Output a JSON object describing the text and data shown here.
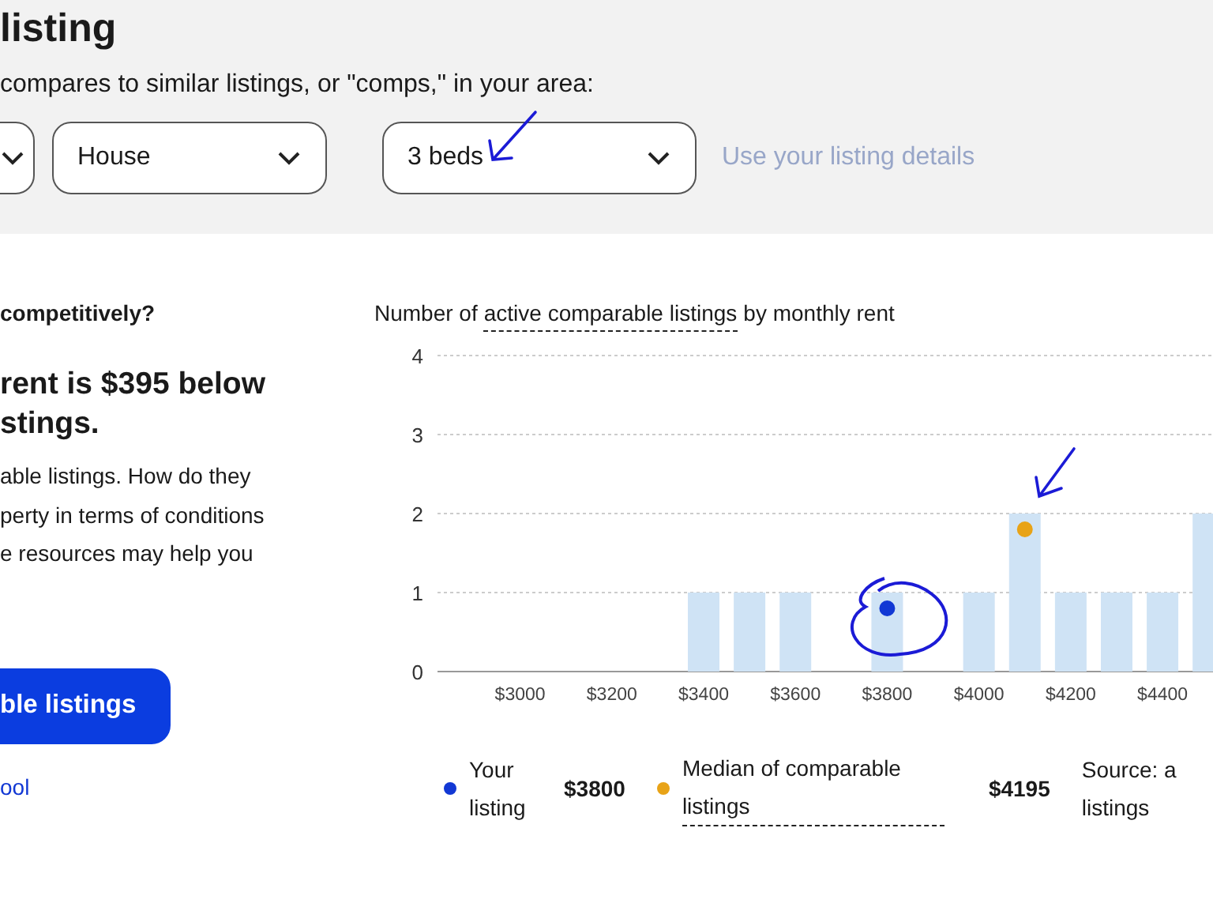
{
  "header": {
    "title": "listing",
    "subtitle": "compares to similar listings, or \"comps,\" in your area:"
  },
  "filters": [
    {
      "kind": "cut"
    },
    {
      "kind": "select",
      "value": "House"
    },
    {
      "kind": "select",
      "value": "3 beds"
    }
  ],
  "filters_link": "Use your listing details",
  "summary": {
    "question": "competitively?",
    "headline": [
      "rent is $395 below",
      "stings."
    ],
    "body": [
      "able listings. How do they",
      "perty in terms of conditions",
      "e resources may help you"
    ],
    "button": "ble listings",
    "link": "ool"
  },
  "chart": {
    "title_before": "Number of",
    "title_term": "active comparable listings",
    "title_after": "by monthly rent",
    "chart_data": {
      "type": "bar",
      "x": [
        3400,
        3500,
        3600,
        3800,
        4000,
        4100,
        4200,
        4300,
        4400,
        4500
      ],
      "values": [
        1,
        1,
        1,
        1,
        1,
        2,
        1,
        1,
        1,
        2
      ],
      "ylim": [
        0,
        4
      ],
      "yticks": [
        0,
        1,
        2,
        3,
        4
      ],
      "xticks": [
        {
          "value": 3000,
          "label": "$3000"
        },
        {
          "value": 3200,
          "label": "$3200"
        },
        {
          "value": 3400,
          "label": "$3400"
        },
        {
          "value": 3600,
          "label": "$3600"
        },
        {
          "value": 3800,
          "label": "$3800"
        },
        {
          "value": 4000,
          "label": "$4000"
        },
        {
          "value": 4200,
          "label": "$4200"
        },
        {
          "value": 4400,
          "label": "$4400"
        }
      ],
      "xlim": [
        2820,
        4510
      ],
      "grid": true
    },
    "legend": [
      {
        "label": "Your listing",
        "value": "$3800",
        "color": "#1238d4",
        "dotted": false
      },
      {
        "label": "Median of comparable listings",
        "value": "$4195",
        "color": "#e8a317",
        "dotted": true
      }
    ],
    "source": "Source: a listings"
  }
}
